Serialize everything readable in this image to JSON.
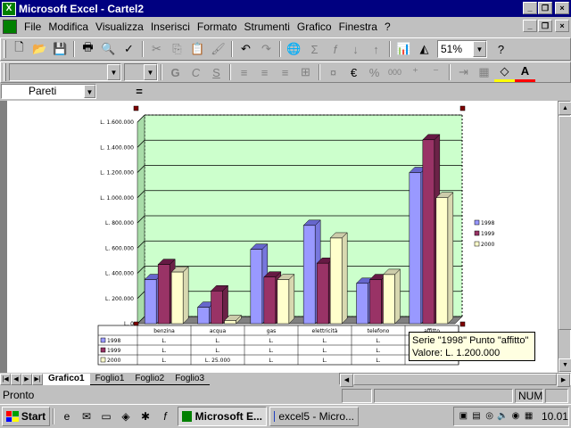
{
  "window": {
    "title": "Microsoft Excel - Cartel2"
  },
  "menu": [
    "File",
    "Modifica",
    "Visualizza",
    "Inserisci",
    "Formato",
    "Strumenti",
    "Grafico",
    "Finestra",
    "?"
  ],
  "toolbar": {
    "zoom": "51%"
  },
  "formula_bar": {
    "name_box": "Pareti",
    "equals": "="
  },
  "chart_data": {
    "type": "bar",
    "categories": [
      "benzina",
      "acqua",
      "gas",
      "elettricità",
      "telefono",
      "affitto"
    ],
    "series": [
      {
        "name": "1998",
        "values": [
          350000,
          130000,
          590000,
          780000,
          320000,
          1200000
        ]
      },
      {
        "name": "1999",
        "values": [
          470000,
          260000,
          370000,
          480000,
          350000,
          1460000
        ]
      },
      {
        "name": "2000",
        "values": [
          410000,
          25000,
          350000,
          680000,
          390000,
          1000000
        ]
      }
    ],
    "ylim": [
      0,
      1600000
    ],
    "y_ticks": [
      "L. 0",
      "L. 200.000",
      "L. 400.000",
      "L. 600.000",
      "L. 800.000",
      "L. 1.000.000",
      "L. 1.200.000",
      "L. 1.400.000",
      "L. 1.600.000"
    ],
    "table_cells": [
      [
        "L.",
        "L.",
        "L.",
        "L.",
        "L.",
        ""
      ],
      [
        "L.",
        "L.",
        "L.",
        "L.",
        "L.",
        ""
      ],
      [
        "L.",
        "L. 25.000",
        "L.",
        "L.",
        "L.",
        ""
      ]
    ],
    "grid": true,
    "legend_position": "right",
    "colors": {
      "1998": "#9999ff",
      "1999": "#993366",
      "2000": "#ffffcc",
      "wall": "#ccffcc"
    }
  },
  "tooltip": {
    "line1": "Serie \"1998\" Punto \"affitto\"",
    "line2": "Valore: L. 1.200.000"
  },
  "sheet_tabs": [
    "Grafico1",
    "Foglio1",
    "Foglio2",
    "Foglio3"
  ],
  "status": {
    "text": "Pronto",
    "num": "NUM"
  },
  "taskbar": {
    "start": "Start",
    "tasks": [
      "Microsoft E...",
      "excel5 - Micro..."
    ],
    "clock": "10.01"
  }
}
